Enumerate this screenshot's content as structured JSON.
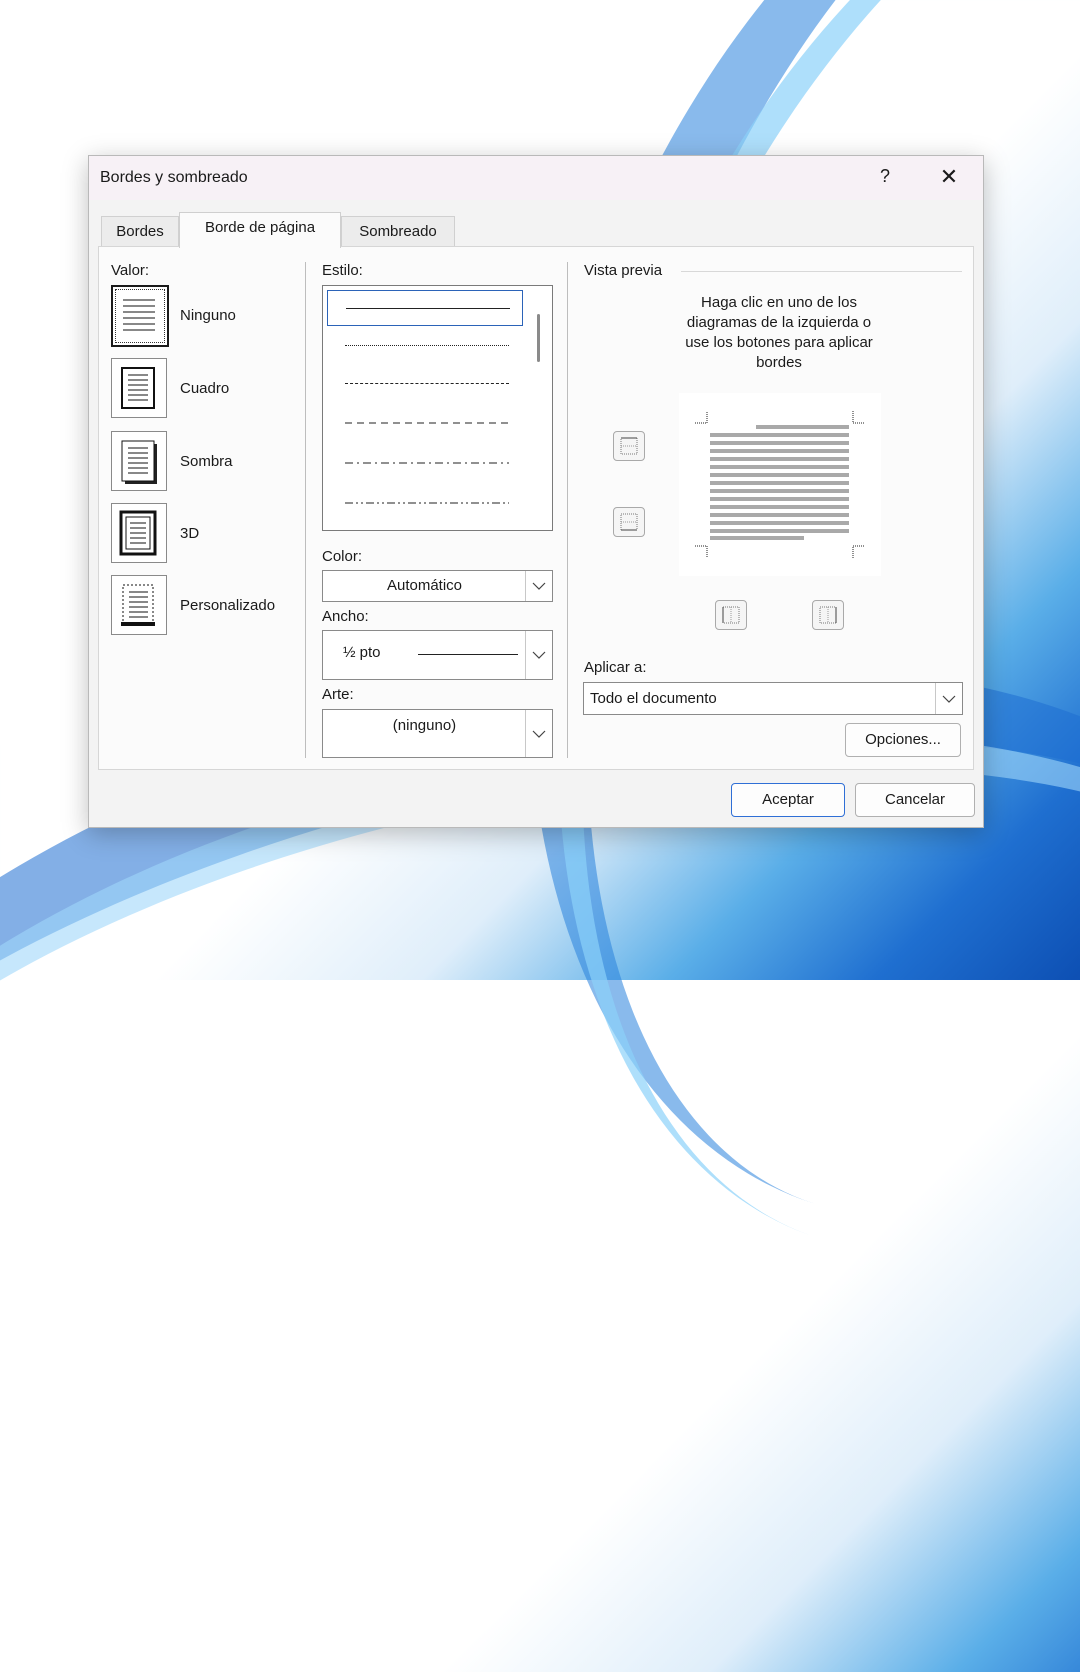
{
  "window": {
    "title": "Bordes y sombreado",
    "help": "?",
    "close": "✕"
  },
  "tabs": [
    {
      "label": "Bordes"
    },
    {
      "label": "Borde de página"
    },
    {
      "label": "Sombreado"
    }
  ],
  "valor": {
    "label": "Valor:",
    "presets": [
      {
        "label": "Ninguno",
        "selected": true
      },
      {
        "label": "Cuadro"
      },
      {
        "label": "Sombra"
      },
      {
        "label": "3D"
      },
      {
        "label": "Personalizado"
      }
    ]
  },
  "estilo": {
    "label": "Estilo:",
    "items": [
      "solid",
      "dotted",
      "dashed-short",
      "dashed",
      "dash-dot",
      "dash-dot-dot"
    ]
  },
  "color": {
    "label": "Color:",
    "value": "Automático"
  },
  "ancho": {
    "label": "Ancho:",
    "value": "½ pto"
  },
  "arte": {
    "label": "Arte:",
    "value": "(ninguno)"
  },
  "preview": {
    "label": "Vista previa",
    "instructions": [
      "Haga clic en uno de los",
      "diagramas de la izquierda o",
      "use los botones para aplicar",
      "bordes"
    ]
  },
  "apply": {
    "label": "Aplicar a:",
    "value": "Todo el documento"
  },
  "buttons": {
    "options": "Opciones...",
    "ok": "Aceptar",
    "cancel": "Cancelar"
  },
  "colors": {
    "accent": "#2f6fd6",
    "selection": "#2b63b8"
  }
}
